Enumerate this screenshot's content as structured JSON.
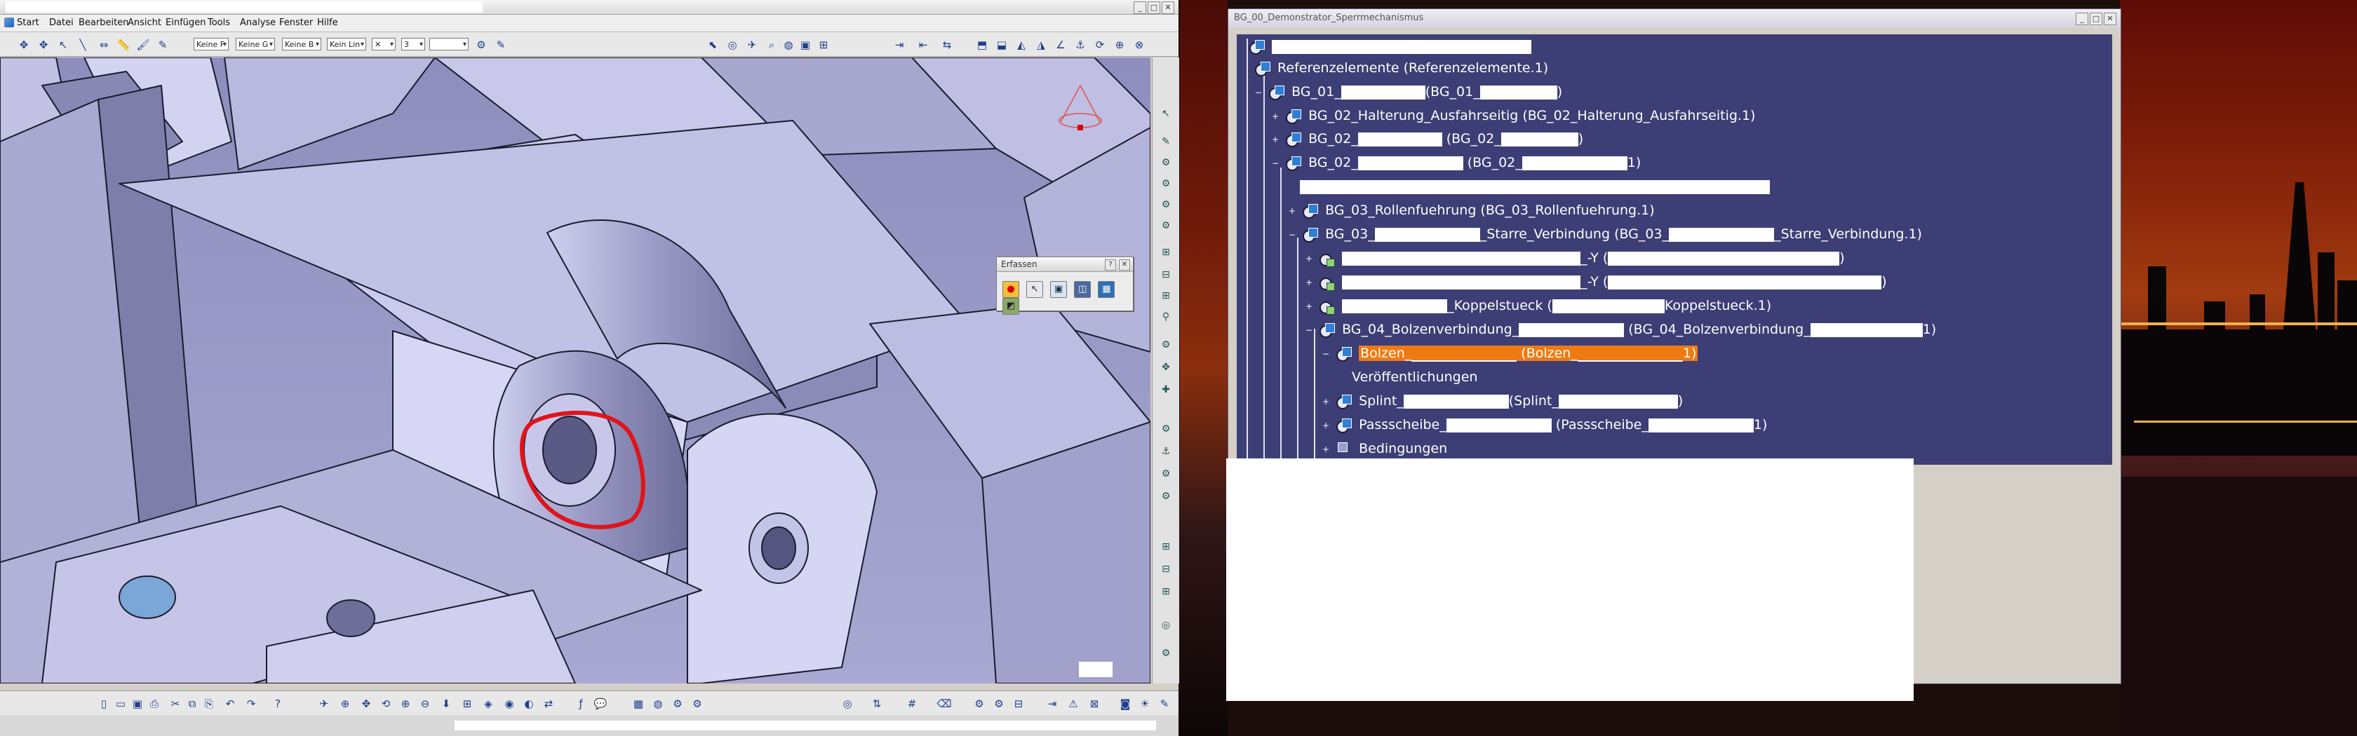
{
  "catia": {
    "menu": [
      "Start",
      "Datei",
      "Bearbeiten",
      "Ansicht",
      "Einfügen",
      "Tools",
      "Analyse",
      "Fenster",
      "Hilfe"
    ],
    "combos": [
      "Keine F",
      "Keine G",
      "Keine B",
      "Kein Lin",
      "3"
    ],
    "palette_title": "Erfassen",
    "window_controls": [
      "_",
      "□",
      "✕"
    ]
  },
  "tree": {
    "window_title": "BG_00_Demonstrator_Sperrmechanismus",
    "items": [
      {
        "text_a": "Referenzelemente (Referenzelemente.1)"
      },
      {
        "text_a": "BG_01_",
        "text_b": "(BG_01_",
        "text_c": ")"
      },
      {
        "text_a": "BG_02_Halterung_Ausfahrseitig (BG_02_Halterung_Ausfahrseitig.1)"
      },
      {
        "text_a": "BG_02_",
        "text_b": "(BG_02_",
        "text_c": ")"
      },
      {
        "text_a": "BG_02_",
        "text_b": "(BG_02_",
        "text_c": "1)"
      },
      {
        "text_a": ""
      },
      {
        "text_a": "BG_03_Rollenfuehrung (BG_03_Rollenfuehrung.1)"
      },
      {
        "text_a": "BG_03_",
        "text_b": "_Starre_Verbindung (BG_03_",
        "text_c": "_Starre_Verbindung.1)"
      },
      {
        "text_a": "_-Y (",
        "text_c": ")"
      },
      {
        "text_a": "_-Y (",
        "text_c": ")"
      },
      {
        "text_a": "_Koppelstueck (",
        "text_c": "Koppelstueck.1)"
      },
      {
        "text_a": "BG_04_Bolzenverbindung_",
        "text_b": "(BG_04_Bolzenverbindung_",
        "text_c": "1)"
      },
      {
        "text_a": "Bolzen_",
        "text_b": "(Bolzen_",
        "text_c": "1)"
      },
      {
        "text_a": "Veröffentlichungen"
      },
      {
        "text_a": "Splint_",
        "text_b": "(Splint_",
        "text_c": ")"
      },
      {
        "text_a": "Passscheibe_",
        "text_b": "(Passscheibe_",
        "text_c": "1)"
      },
      {
        "text_a": "Bedingungen"
      }
    ]
  },
  "colors": {
    "viewport_bg": "#9c9bc7",
    "tree_bg": "#3c3e75",
    "selection": "#f07a12",
    "annotation": "#e0141a"
  }
}
